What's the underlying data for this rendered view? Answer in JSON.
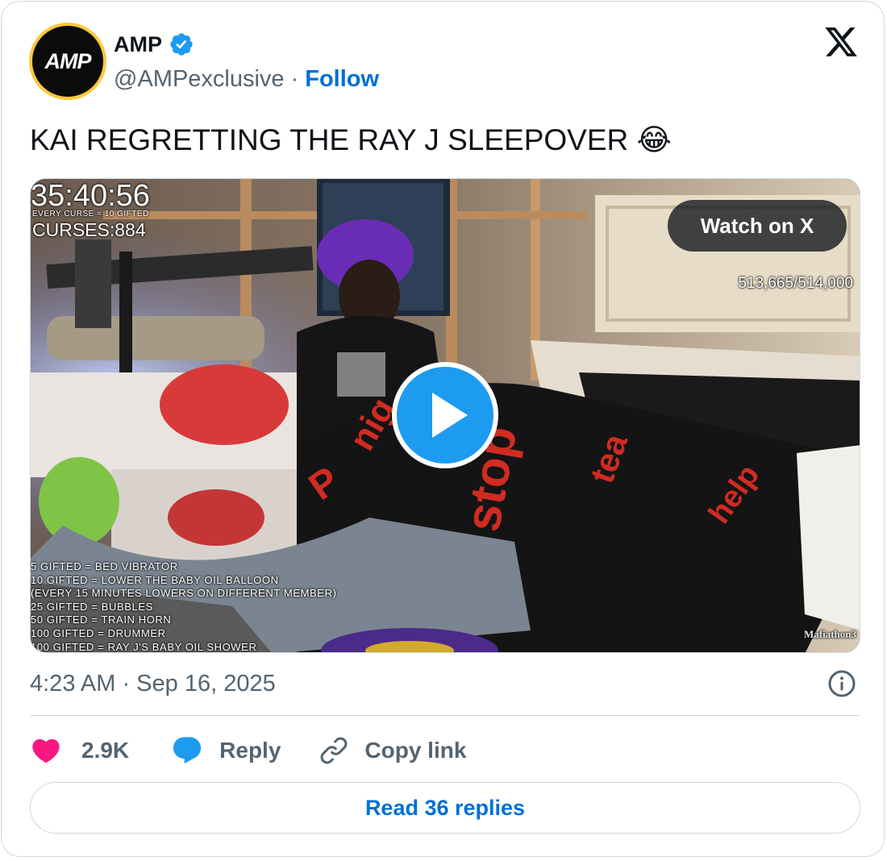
{
  "author": {
    "display_name": "AMP",
    "avatar_text": "AMP",
    "handle": "@AMPexclusive",
    "separator": "·",
    "follow_label": "Follow",
    "verified_icon": "verified-badge-icon"
  },
  "tweet": {
    "text": "KAI REGRETTING THE RAY J SLEEPOVER 😂"
  },
  "media": {
    "timer": "35:40:56",
    "every_curse": "EVERY CURSE = 10 GIFTED",
    "curses": "CURSES:884",
    "goal": "513,665/514,000",
    "brand_watermark": "Mafiathon3",
    "watch_label": "Watch on X",
    "gift_list": [
      "5 GIFTED = BED VIBRATOR",
      "10 GIFTED =  LOWER THE BABY OIL BALLOON",
      "(EVERY 15 MINUTES LOWERS ON DIFFERENT MEMBER)",
      "25 GIFTED = BUBBLES",
      "50 GIFTED = TRAIN HORN",
      "100 GIFTED = DRUMMER",
      "100 GIFTED = RAY J'S BABY OIL SHOWER"
    ]
  },
  "meta": {
    "timestamp": "4:23 AM · Sep 16, 2025"
  },
  "actions": {
    "like_count": "2.9K",
    "reply_label": "Reply",
    "copy_label": "Copy link"
  },
  "read_replies_label": "Read 36 replies",
  "colors": {
    "link_blue": "#006fd6",
    "verified_blue": "#1d9bf0",
    "like_pink": "#f91880",
    "muted_text": "#536471",
    "border": "#cfd9de"
  }
}
